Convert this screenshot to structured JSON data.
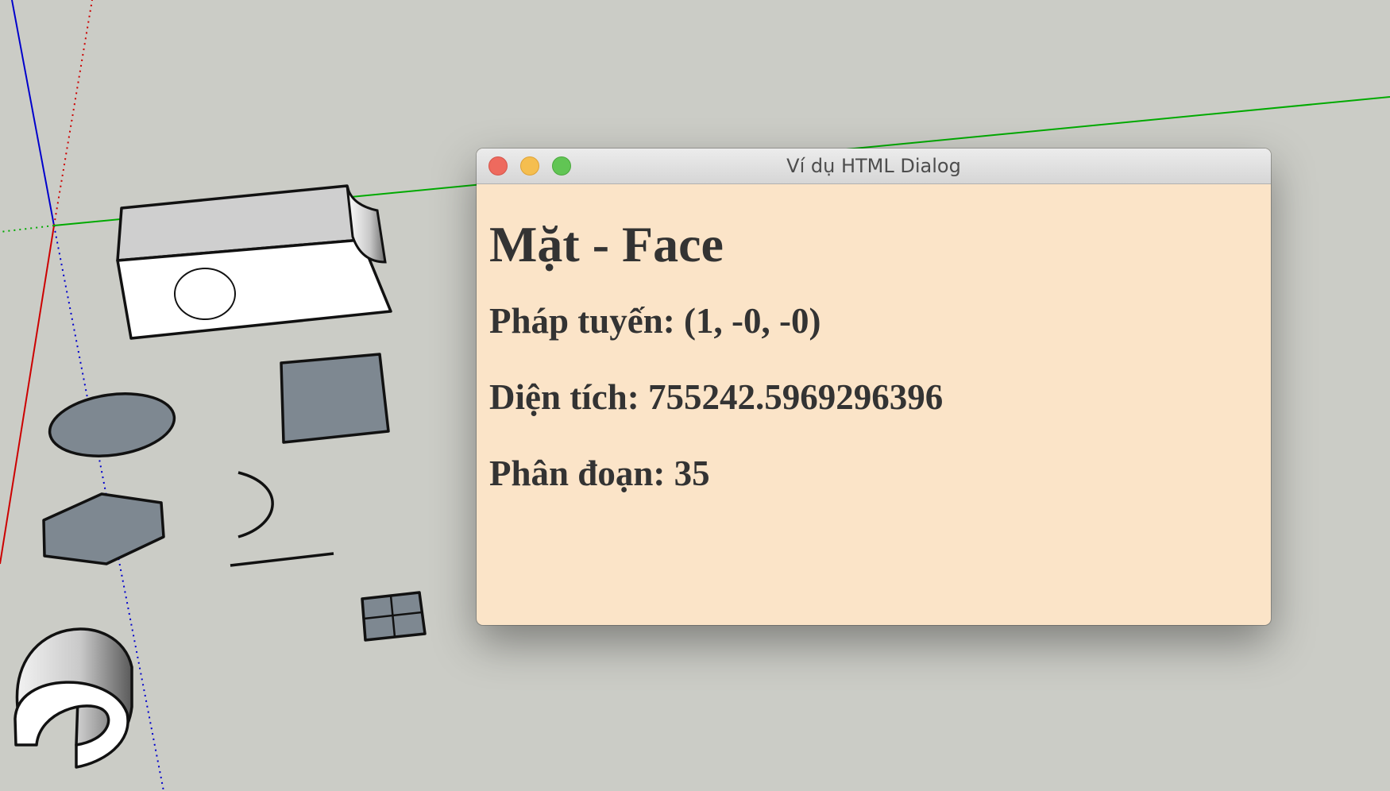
{
  "canvas": {
    "background": "#cbccc6",
    "axes": {
      "red": "#cc0000",
      "green": "#00aa00",
      "blue": "#0000cc"
    },
    "face_color": "#7e8891",
    "box_top_color": "#cfcfcf",
    "box_front_color": "#ffffff",
    "edge_color": "#111111"
  },
  "dialog": {
    "window_title": "Ví dụ HTML Dialog",
    "background": "#fbe4c8",
    "heading": "Mặt - Face",
    "normal_line": "Pháp tuyến: (1, -0, -0)",
    "area_line": "Diện tích: 755242.5969296396",
    "segments_line": "Phân đoạn: 35"
  }
}
